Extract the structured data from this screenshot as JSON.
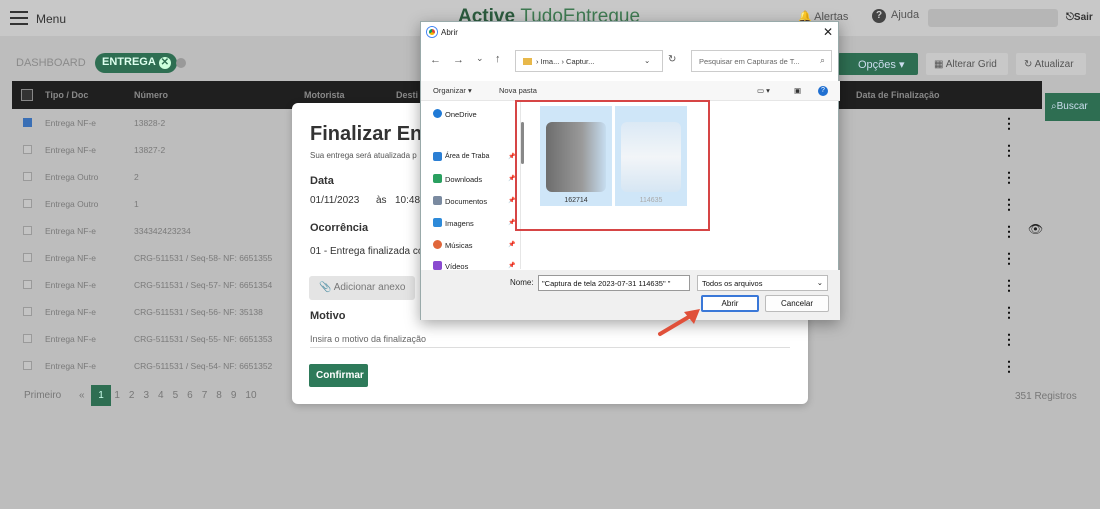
{
  "header": {
    "menu_label": "Menu",
    "brand_bold": "Active",
    "brand_light": "TudoEntregue",
    "alerts": "Alertas",
    "help": "Ajuda",
    "logout": "Sair"
  },
  "filters": {
    "dashboard_tab": "DASHBOARD",
    "chip_label": "ENTREGA"
  },
  "toolbar": {
    "options": "Opções",
    "alter_grid": "Alterar Grid",
    "update": "Atualizar",
    "search": "Buscar"
  },
  "table": {
    "columns": [
      "Tipo / Doc",
      "Número",
      "Motorista",
      "Desti",
      "Data de Finalização"
    ],
    "rows": [
      {
        "type": "Entrega NF-e",
        "number": "13828-2",
        "checked": true
      },
      {
        "type": "Entrega NF-e",
        "number": "13827-2",
        "checked": false
      },
      {
        "type": "Entrega Outro",
        "number": "2",
        "checked": false
      },
      {
        "type": "Entrega Outro",
        "number": "1",
        "checked": false
      },
      {
        "type": "Entrega NF-e",
        "number": "334342423234",
        "checked": false
      },
      {
        "type": "Entrega NF-e",
        "number": "CRG-511531 / Seq-58- NF: 6651355",
        "checked": false
      },
      {
        "type": "Entrega NF-e",
        "number": "CRG-511531 / Seq-57- NF: 6651354",
        "checked": false
      },
      {
        "type": "Entrega NF-e",
        "number": "CRG-511531 / Seq-56- NF: 35138",
        "checked": false
      },
      {
        "type": "Entrega NF-e",
        "number": "CRG-511531 / Seq-55- NF: 6651353",
        "checked": false
      },
      {
        "type": "Entrega NF-e",
        "number": "CRG-511531 / Seq-54- NF: 6651352",
        "checked": false
      }
    ]
  },
  "pagination": {
    "first": "Primeiro",
    "prev": "«",
    "pages": [
      "1",
      "2",
      "3",
      "4",
      "5",
      "6",
      "7",
      "8",
      "9",
      "10"
    ],
    "active": "1",
    "records": "351 Registros"
  },
  "modal": {
    "title": "Finalizar Entr",
    "subtitle": "Sua entrega será atualizada p",
    "date_label": "Data",
    "date_value": "01/11/2023",
    "at": "às",
    "time_value": "10:48",
    "occurrence_label": "Ocorrência",
    "occurrence_value": "01 - Entrega finalizada co",
    "attach_button": "Adicionar anexo",
    "reason_label": "Motivo",
    "reason_placeholder": "Insira o motivo da finalização",
    "confirm_button": "Confirmar"
  },
  "file_dialog": {
    "title": "Abrir",
    "address": [
      "Ima...",
      "Captur..."
    ],
    "search_placeholder": "Pesquisar em Capturas de T...",
    "organize": "Organizar",
    "new_folder": "Nova pasta",
    "sidebar": [
      "OneDrive",
      "Área de Traba",
      "Downloads",
      "Documentos",
      "Imagens",
      "Músicas",
      "Vídeos"
    ],
    "files": [
      "162714",
      "114635"
    ],
    "filename_label": "Nome:",
    "filename_value": "\"Captura de tela 2023-07-31 114635\" \"",
    "filetype_value": "Todos os arquivos",
    "open_button": "Abrir",
    "cancel_button": "Cancelar"
  }
}
